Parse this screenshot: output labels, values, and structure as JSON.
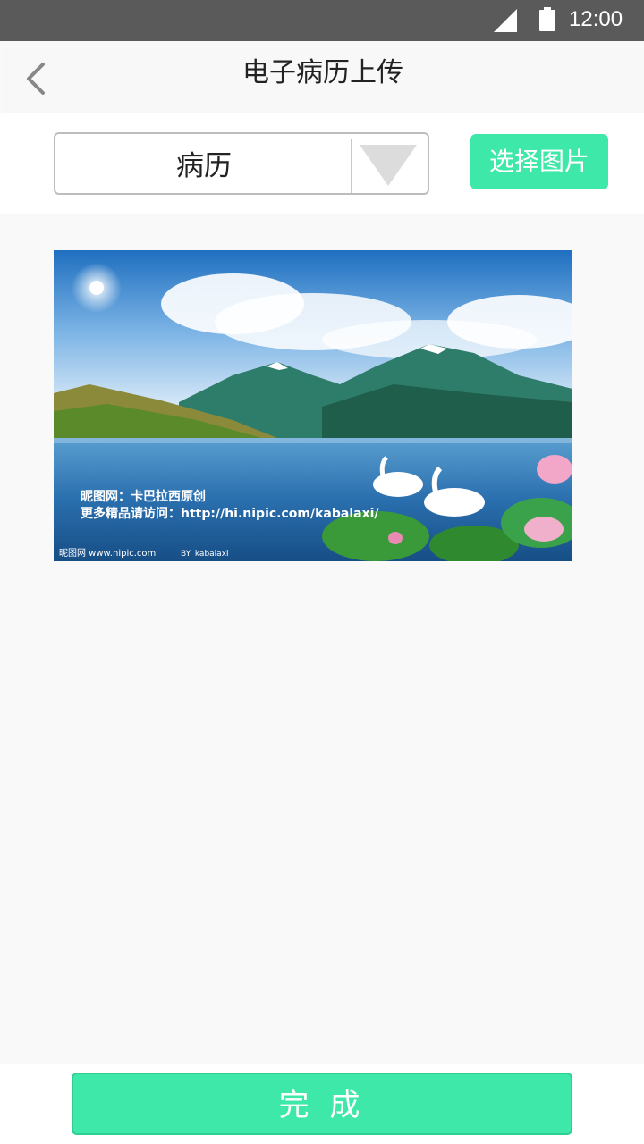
{
  "status_bar": {
    "time": "12:00",
    "icons": [
      "cell-signal-icon",
      "battery-icon"
    ]
  },
  "header": {
    "title": "电子病历上传",
    "back_icon": "chevron-left-icon"
  },
  "upload": {
    "category": {
      "selected": "病历",
      "arrow_icon": "triangle-down-icon"
    },
    "choose_image_label": "选择图片"
  },
  "preview": {
    "watermark_line1": "昵图网：卡巴拉西原创",
    "watermark_line2": "更多精品请访问：http://hi.nipic.com/kabalaxi/",
    "watermark_logo": "昵图网 www.nipic.com",
    "watermark_author": "BY: kabalaxi"
  },
  "footer": {
    "done_label": "完 成"
  },
  "colors": {
    "accent": "#3de8a8",
    "status_bar": "#5a5a5a",
    "background": "#f9f9f9"
  }
}
